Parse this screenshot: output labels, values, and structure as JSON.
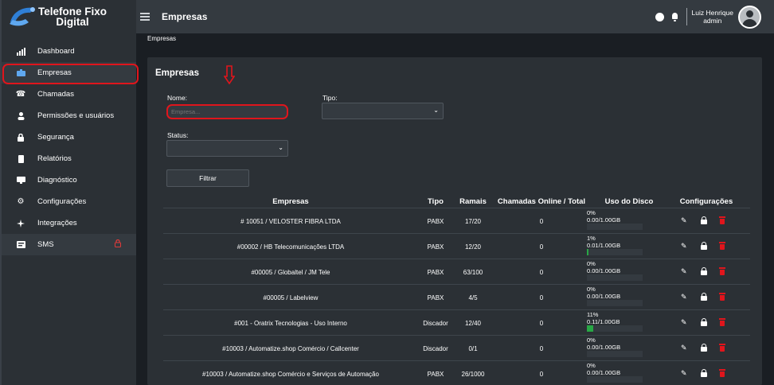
{
  "brand": {
    "line1": "Telefone Fixo",
    "line2": "Digital"
  },
  "sidebar": {
    "items": [
      {
        "label": "Dashboard",
        "icon": "chart-icon"
      },
      {
        "label": "Empresas",
        "icon": "briefcase-icon"
      },
      {
        "label": "Chamadas",
        "icon": "phone-icon"
      },
      {
        "label": "Permissões e usuários",
        "icon": "user-icon"
      },
      {
        "label": "Segurança",
        "icon": "lock-icon"
      },
      {
        "label": "Relatórios",
        "icon": "document-icon"
      },
      {
        "label": "Diagnóstico",
        "icon": "monitor-icon"
      },
      {
        "label": "Configurações",
        "icon": "gear-icon"
      },
      {
        "label": "Integrações",
        "icon": "puzzle-icon"
      },
      {
        "label": "SMS",
        "icon": "message-icon"
      }
    ]
  },
  "topbar": {
    "title": "Empresas",
    "user_name": "Luiz Henrique",
    "user_role": "admin"
  },
  "breadcrumb": "Empresas",
  "panel": {
    "title": "Empresas",
    "nome_label": "Nome:",
    "nome_placeholder": "Empresa...",
    "tipo_label": "Tipo:",
    "status_label": "Status:",
    "filter_label": "Filtrar"
  },
  "table": {
    "headers": [
      "Empresas",
      "Tipo",
      "Ramais",
      "Chamadas Online / Total",
      "Uso do Disco",
      "Configurações"
    ],
    "rows": [
      {
        "empresa": "# 10051 / VELOSTER FIBRA LTDA",
        "tipo": "PABX",
        "ramais": "17/20",
        "chamadas": "0",
        "pct": "0%",
        "uso": "0.00/1.00GB",
        "fill": 0
      },
      {
        "empresa": "#00002 / HB Telecomunicações LTDA",
        "tipo": "PABX",
        "ramais": "12/20",
        "chamadas": "0",
        "pct": "1%",
        "uso": "0.01/1.00GB",
        "fill": 1
      },
      {
        "empresa": "#00005 / Globaltel / JM Tele",
        "tipo": "PABX",
        "ramais": "63/100",
        "chamadas": "0",
        "pct": "0%",
        "uso": "0.00/1.00GB",
        "fill": 0
      },
      {
        "empresa": "#00005 / Labelview",
        "tipo": "PABX",
        "ramais": "4/5",
        "chamadas": "0",
        "pct": "0%",
        "uso": "0.00/1.00GB",
        "fill": 0
      },
      {
        "empresa": "#001 - Oratrix Tecnologias - Uso Interno",
        "tipo": "Discador",
        "ramais": "12/40",
        "chamadas": "0",
        "pct": "11%",
        "uso": "0.11/1.00GB",
        "fill": 11
      },
      {
        "empresa": "#10003 / Automatize.shop Comércio / Callcenter",
        "tipo": "Discador",
        "ramais": "0/1",
        "chamadas": "0",
        "pct": "0%",
        "uso": "0.00/1.00GB",
        "fill": 0
      },
      {
        "empresa": "#10003 / Automatize.shop Comércio e Serviços de Automação",
        "tipo": "PABX",
        "ramais": "26/1000",
        "chamadas": "0",
        "pct": "0%",
        "uso": "0.00/1.00GB",
        "fill": 0
      }
    ]
  },
  "colors": {
    "accent_red": "#e0151c",
    "progress_green": "#28a745"
  }
}
